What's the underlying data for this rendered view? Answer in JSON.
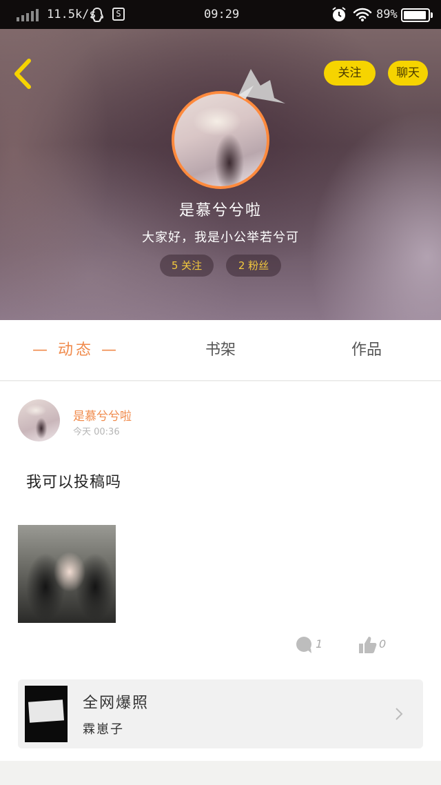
{
  "status_bar": {
    "network_speed": "11.5k/s",
    "time": "09:29",
    "battery": "89%",
    "icons": [
      "signal-icon",
      "qq-icon",
      "s-app-icon",
      "alarm-icon",
      "wifi-icon",
      "battery-icon"
    ]
  },
  "header": {
    "follow_button": "关注",
    "chat_button": "聊天",
    "nickname": "是慕兮兮啦",
    "bio": "大家好，我是小公举若兮可",
    "following_count_label": "5 关注",
    "fans_count_label": "2 粉丝"
  },
  "tabs": [
    {
      "label": "— 动态 —",
      "active": true
    },
    {
      "label": "书架",
      "active": false
    },
    {
      "label": "作品",
      "active": false
    }
  ],
  "post": {
    "author": "是慕兮兮啦",
    "time": "今天 00:36",
    "text": "我可以投稿吗",
    "comment_count": "1",
    "like_count": "0",
    "book": {
      "title": "全网爆照",
      "author": "霖崽子"
    }
  },
  "colors": {
    "accent_orange": "#f08a4b",
    "button_yellow": "#f6d400",
    "stat_text": "#f3c93d"
  }
}
